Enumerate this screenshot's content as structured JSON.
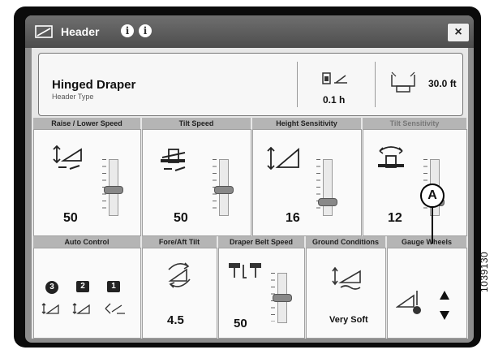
{
  "window": {
    "title": "Header",
    "info_glyph": "i",
    "close_label": "×"
  },
  "header_info": {
    "name": "Hinged Draper",
    "label": "Header Type",
    "height_value": "0.1 h",
    "width_value": "30.0 ft"
  },
  "row1": [
    {
      "label": "Raise / Lower Speed",
      "value": "50",
      "level": 0.45
    },
    {
      "label": "Tilt Speed",
      "value": "50",
      "level": 0.45
    },
    {
      "label": "Height Sensitivity",
      "value": "16",
      "level": 0.2
    },
    {
      "label": "Tilt Sensitivity",
      "value": "12",
      "level": 0.2
    }
  ],
  "row2": [
    {
      "label": "Auto Control"
    },
    {
      "label": "Fore/Aft Tilt",
      "value": "4.5"
    },
    {
      "label": "Draper Belt Speed",
      "value": "50",
      "level": 0.5
    },
    {
      "label": "Ground Conditions",
      "value": "Very Soft"
    },
    {
      "label": "Gauge Wheels"
    }
  ],
  "auto_control_badges": [
    "3",
    "2",
    "1"
  ],
  "callout_label": "A",
  "figure_number": "1039130"
}
